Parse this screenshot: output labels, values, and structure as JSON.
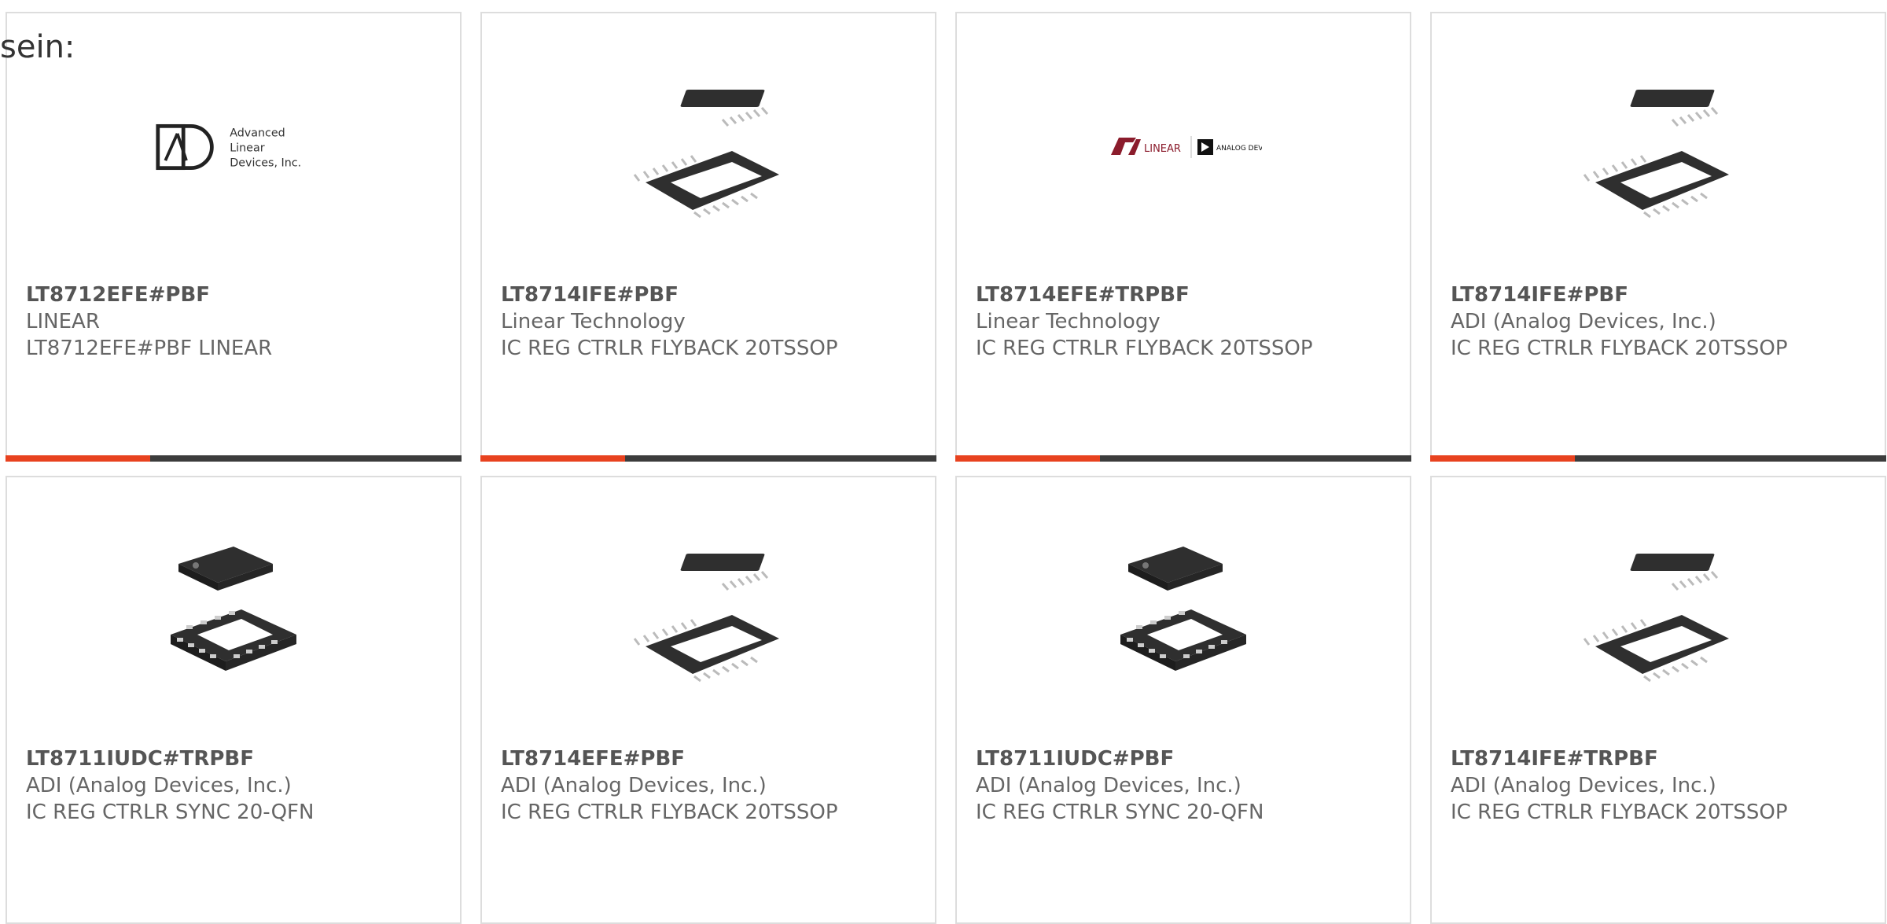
{
  "intro_text": "sein:",
  "colors": {
    "accent": "#e8421f",
    "bar": "#3c3c3c",
    "border": "#dddddd"
  },
  "cards": [
    {
      "part_number": "LT8712EFE#PBF",
      "manufacturer": "LINEAR",
      "description": "LT8712EFE#PBF LINEAR",
      "image": "advanced-linear-devices-logo",
      "logo_lines": [
        "Advanced",
        "Linear",
        "Devices, Inc."
      ]
    },
    {
      "part_number": "LT8714IFE#PBF",
      "manufacturer": "Linear Technology",
      "description": "IC REG CTRLR FLYBACK 20TSSOP",
      "image": "tssop-chip"
    },
    {
      "part_number": "LT8714EFE#TRPBF",
      "manufacturer": "Linear Technology",
      "description": "IC REG CTRLR FLYBACK 20TSSOP",
      "image": "linear-analog-devices-logo",
      "logo_left": "LINEAR",
      "logo_right": "ANALOG DEVICES"
    },
    {
      "part_number": "LT8714IFE#PBF",
      "manufacturer": "ADI (Analog Devices, Inc.)",
      "description": "IC REG CTRLR FLYBACK 20TSSOP",
      "image": "tssop-chip"
    },
    {
      "part_number": "LT8711IUDC#TRPBF",
      "manufacturer": "ADI (Analog Devices, Inc.)",
      "description": "IC REG CTRLR SYNC 20-QFN",
      "image": "qfn-chip"
    },
    {
      "part_number": "LT8714EFE#PBF",
      "manufacturer": "ADI (Analog Devices, Inc.)",
      "description": "IC REG CTRLR FLYBACK 20TSSOP",
      "image": "tssop-chip"
    },
    {
      "part_number": "LT8711IUDC#PBF",
      "manufacturer": "ADI (Analog Devices, Inc.)",
      "description": "IC REG CTRLR SYNC 20-QFN",
      "image": "qfn-chip"
    },
    {
      "part_number": "LT8714IFE#TRPBF",
      "manufacturer": "ADI (Analog Devices, Inc.)",
      "description": "IC REG CTRLR FLYBACK 20TSSOP",
      "image": "tssop-chip"
    }
  ]
}
